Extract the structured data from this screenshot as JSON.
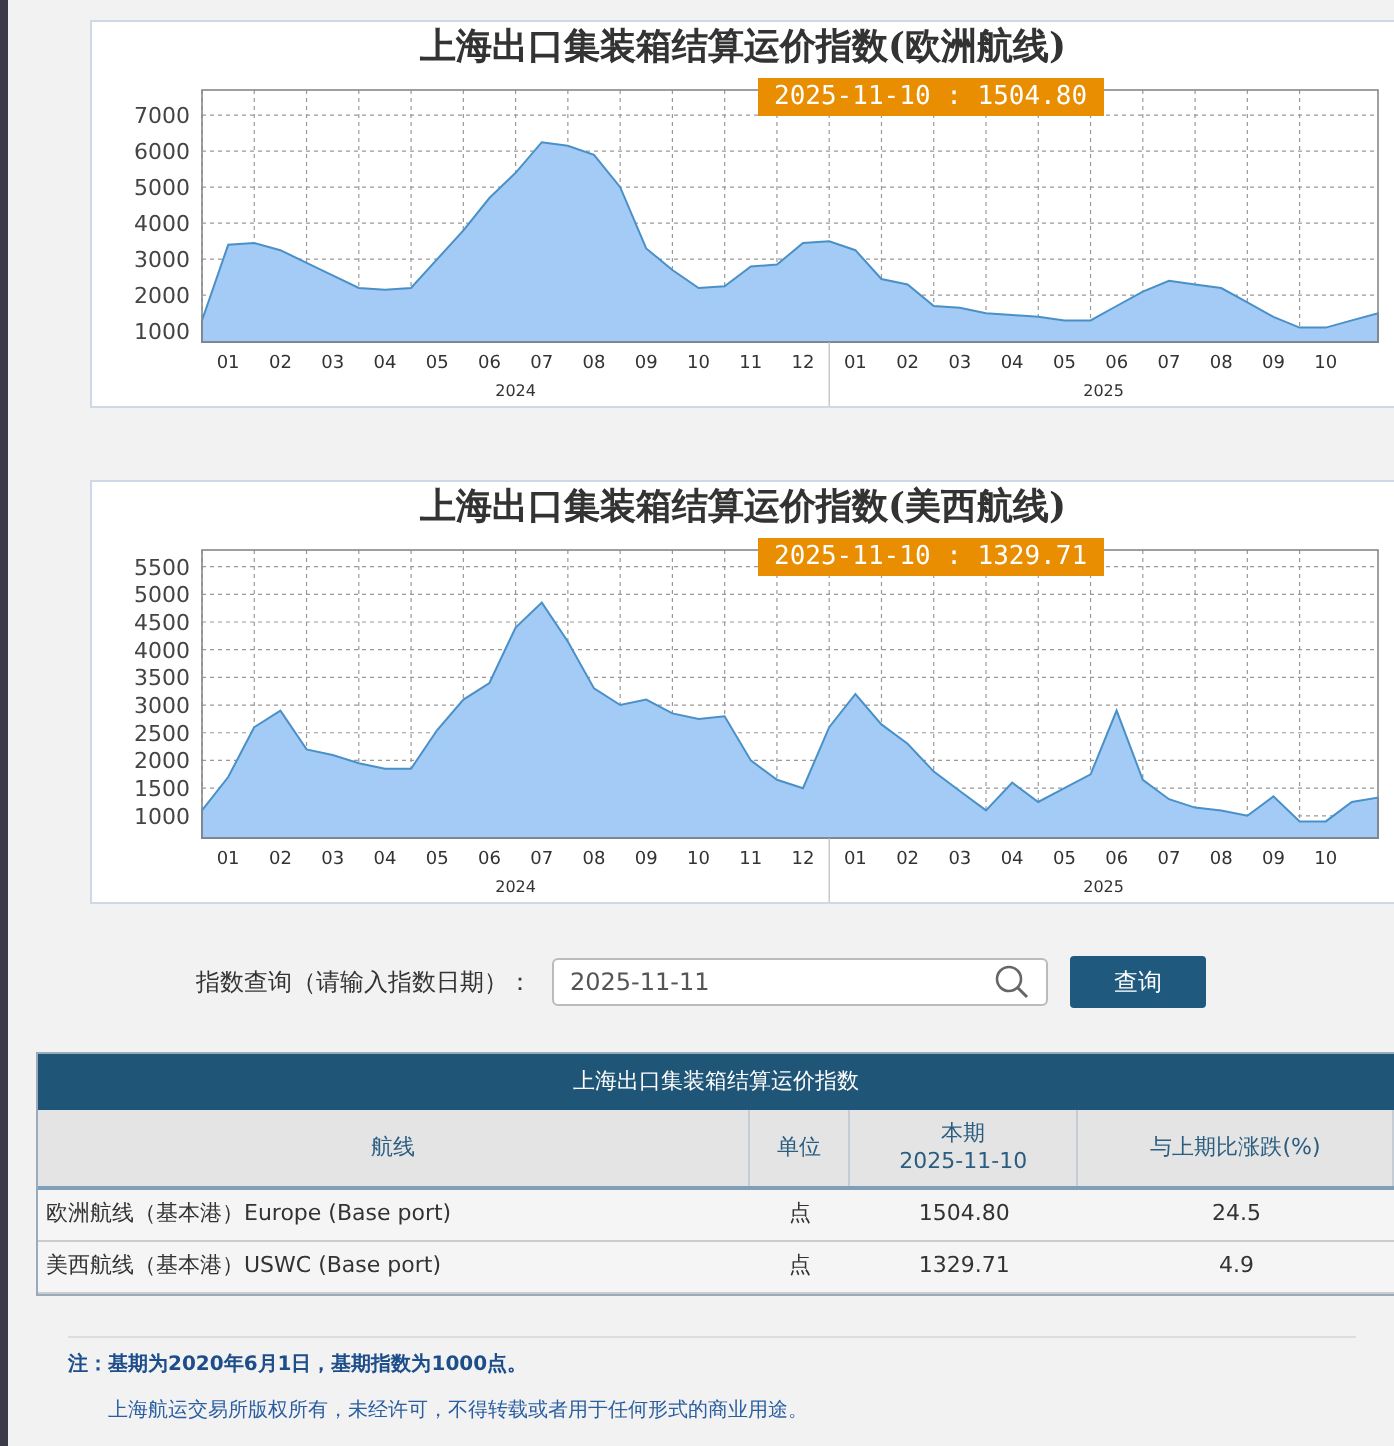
{
  "charts": [
    {
      "title": "上海出口集装箱结算运价指数(欧洲航线)",
      "badge": "2025-11-10 : 1504.80",
      "years": [
        "2024",
        "2025"
      ],
      "chart_data": {
        "type": "area",
        "grid": true,
        "categories": [
          null,
          "01",
          null,
          "02",
          null,
          "03",
          null,
          "04",
          null,
          "05",
          null,
          "06",
          null,
          "07",
          null,
          "08",
          null,
          "09",
          null,
          "10",
          null,
          "11",
          null,
          "12",
          null,
          "01",
          null,
          "02",
          null,
          "03",
          null,
          "04",
          null,
          "05",
          null,
          "06",
          null,
          "07",
          null,
          "08",
          null,
          "09",
          null,
          "10",
          null,
          null
        ],
        "ylim": [
          700,
          7700
        ],
        "yticks": [
          1000,
          2000,
          3000,
          4000,
          5000,
          6000,
          7000
        ],
        "series": [
          {
            "color": "#a3cbf5",
            "values": [
              1300,
              3400,
              3450,
              3250,
              2900,
              2550,
              2200,
              2150,
              2200,
              3000,
              3800,
              4700,
              5400,
              6250,
              6150,
              5900,
              5000,
              3300,
              2700,
              2200,
              2250,
              2800,
              2850,
              3450,
              3500,
              3250,
              2450,
              2300,
              1700,
              1650,
              1500,
              1450,
              1400,
              1300,
              1300,
              1700,
              2100,
              2400,
              2300,
              2200,
              1800,
              1400,
              1100,
              1100,
              1300,
              1500
            ]
          }
        ]
      }
    },
    {
      "title": "上海出口集装箱结算运价指数(美西航线)",
      "badge": "2025-11-10 : 1329.71",
      "years": [
        "2024",
        "2025"
      ],
      "chart_data": {
        "type": "area",
        "grid": true,
        "categories": [
          null,
          "01",
          null,
          "02",
          null,
          "03",
          null,
          "04",
          null,
          "05",
          null,
          "06",
          null,
          "07",
          null,
          "08",
          null,
          "09",
          null,
          "10",
          null,
          "11",
          null,
          "12",
          null,
          "01",
          null,
          "02",
          null,
          "03",
          null,
          "04",
          null,
          "05",
          null,
          "06",
          null,
          "07",
          null,
          "08",
          null,
          "09",
          null,
          "10",
          null,
          null
        ],
        "ylim": [
          600,
          5800
        ],
        "yticks": [
          1000,
          1500,
          2000,
          2500,
          3000,
          3500,
          4000,
          4500,
          5000,
          5500
        ],
        "series": [
          {
            "color": "#a3cbf5",
            "values": [
              1100,
              1700,
              2600,
              2900,
              2200,
              2100,
              1950,
              1850,
              1850,
              2550,
              3100,
              3400,
              4400,
              4850,
              4150,
              3300,
              3000,
              3100,
              2850,
              2750,
              2800,
              2000,
              1650,
              1500,
              2600,
              3200,
              2650,
              2300,
              1800,
              1450,
              1100,
              1600,
              1250,
              1500,
              1750,
              2900,
              1650,
              1300,
              1150,
              1100,
              1000,
              1350,
              900,
              900,
              1250,
              1330
            ]
          }
        ]
      }
    }
  ],
  "query": {
    "label": "指数查询（请输入指数日期）：",
    "value": "2025-11-11",
    "button": "查询"
  },
  "table": {
    "title": "上海出口集装箱结算运价指数",
    "columns": [
      "航线",
      "单位",
      "本期\n2025-11-10",
      "与上期比涨跌(%)"
    ],
    "rows": [
      [
        "欧洲航线（基本港）Europe (Base port)",
        "点",
        "1504.80",
        "24.5"
      ],
      [
        "美西航线（基本港）USWC (Base port)",
        "点",
        "1329.71",
        "4.9"
      ]
    ]
  },
  "note": "注：基期为2020年6月1日，基期指数为1000点。",
  "copyright": "上海航运交易所版权所有，未经许可，不得转载或者用于任何形式的商业用途。"
}
